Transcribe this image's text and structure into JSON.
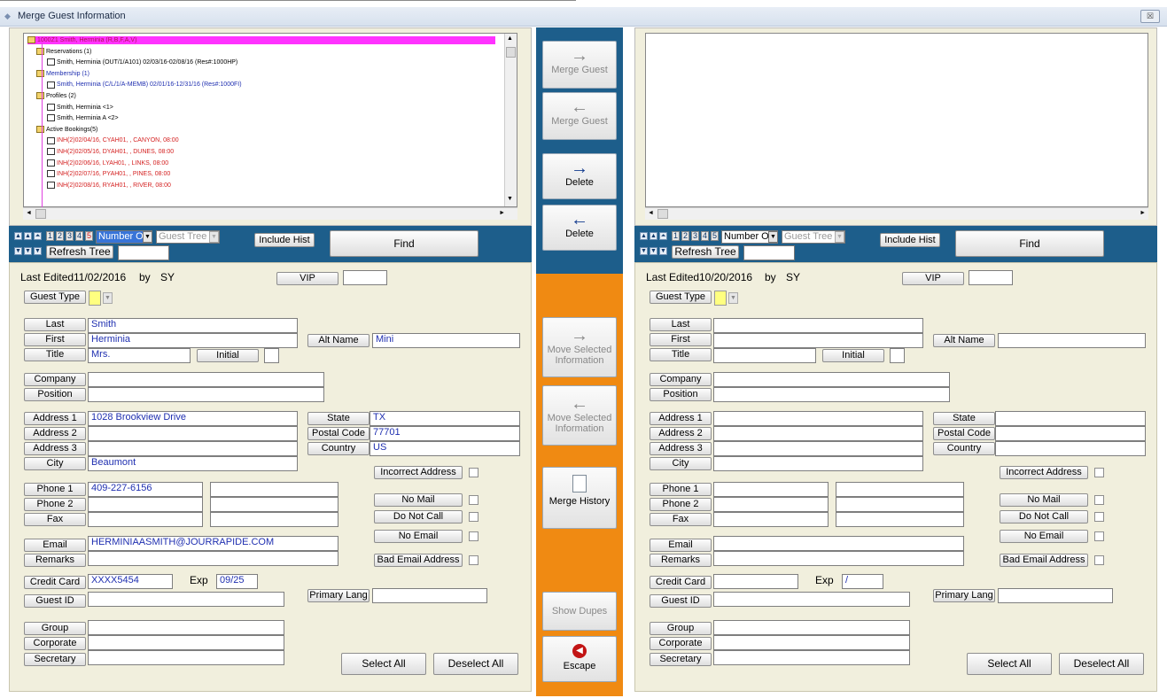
{
  "window": {
    "title": "Merge Guest Information",
    "close_label": "☒"
  },
  "tree_left": {
    "rows": [
      {
        "text": "1000Z1 Smith, Herminia (R,B,F,A,V)",
        "color": "#b01050",
        "kind": "folder"
      },
      {
        "text": "Reservations (1)",
        "color": "#000000",
        "kind": "folder"
      },
      {
        "text": "Smith, Herminia (OUT/1/A101) 02/03/16-02/08/16 (Res#:1000HP)",
        "color": "#000000",
        "kind": "doc"
      },
      {
        "text": "Membership (1)",
        "color": "#1f2fb0",
        "kind": "folder"
      },
      {
        "text": "Smith, Herminia (C/L/1/A-MEMB) 02/01/16-12/31/16 (Res#:1000FI)",
        "color": "#1f2fb0",
        "kind": "doc"
      },
      {
        "text": "Profiles (2)",
        "color": "#000000",
        "kind": "folder"
      },
      {
        "text": "Smith, Herminia <1>",
        "color": "#000000",
        "kind": "doc"
      },
      {
        "text": "Smith, Herminia A <2>",
        "color": "#000000",
        "kind": "doc"
      },
      {
        "text": "Active Bookings(5)",
        "color": "#000000",
        "kind": "folder"
      },
      {
        "text": "INH(2)02/04/16, CYAH01, , CANYON, 08:00",
        "color": "#d41f1f",
        "kind": "doc"
      },
      {
        "text": "INH(2)02/05/16, DYAH01, , DUNES, 08:00",
        "color": "#d41f1f",
        "kind": "doc"
      },
      {
        "text": "INH(2)02/06/16, LYAH01, , LINKS, 08:00",
        "color": "#d41f1f",
        "kind": "doc"
      },
      {
        "text": "INH(2)02/07/16, PYAH01, , PINES, 08:00",
        "color": "#d41f1f",
        "kind": "doc"
      },
      {
        "text": "INH(2)02/08/16, RYAH01, , RIVER, 08:00",
        "color": "#d41f1f",
        "kind": "doc"
      }
    ]
  },
  "toolbar": {
    "nums": [
      "1",
      "2",
      "3",
      "4",
      "5"
    ],
    "sort_left": "Number O",
    "sort_right": "Number Or",
    "tree_mode": "Guest Tree",
    "include_hist": "Include Hist",
    "refresh_tree": "Refresh Tree",
    "find": "Find"
  },
  "middle": {
    "merge_guest_right": "Merge Guest",
    "merge_guest_left": "Merge Guest",
    "delete_right": "Delete",
    "delete_left": "Delete",
    "move_selected_right": "Move Selected Information",
    "move_selected_left": "Move Selected Information",
    "merge_history": "Merge History",
    "show_dupes": "Show Dupes",
    "escape": "Escape",
    "arrow_right": "→",
    "arrow_left": "←"
  },
  "labels": {
    "last_edited": "Last Edited",
    "by": "by",
    "vip": "VIP",
    "guest_type": "Guest Type",
    "last": "Last",
    "first": "First",
    "title": "Title",
    "alt_name": "Alt Name",
    "initial": "Initial",
    "company": "Company",
    "position": "Position",
    "address1": "Address 1",
    "address2": "Address 2",
    "address3": "Address 3",
    "city": "City",
    "state": "State",
    "postal_code": "Postal Code",
    "country": "Country",
    "incorrect_address": "Incorrect Address",
    "phone1": "Phone 1",
    "phone2": "Phone 2",
    "fax": "Fax",
    "no_mail": "No Mail",
    "do_not_call": "Do Not Call",
    "no_email": "No Email",
    "email": "Email",
    "remarks": "Remarks",
    "bad_email": "Bad Email Address",
    "credit_card": "Credit Card",
    "exp": "Exp",
    "guest_id": "Guest ID",
    "primary_lang": "Primary Lang",
    "group": "Group",
    "corporate": "Corporate",
    "secretary": "Secretary",
    "select_all": "Select All",
    "deselect_all": "Deselect All"
  },
  "left": {
    "edited_date": "11/02/2016",
    "edited_by": "SY",
    "last": "Smith",
    "first": "Herminia",
    "title": "Mrs.",
    "alt_name": "Mini",
    "address1": "1028 Brookview Drive",
    "city": "Beaumont",
    "state": "TX",
    "postal_code": "77701",
    "country": "US",
    "phone1": "409-227-6156",
    "email": "HERMINIAASMITH@JOURRAPIDE.COM",
    "credit_card": "XXXX5454",
    "exp": "09/25"
  },
  "right": {
    "edited_date": "10/20/2016",
    "edited_by": "SY",
    "exp": "/"
  },
  "colors": {
    "nav": "#1d5e8b",
    "mid_top": "#1d5e8b",
    "mid_bottom": "#f08a12",
    "panel": "#f1efdd",
    "selected_row": "#ff33ff"
  }
}
